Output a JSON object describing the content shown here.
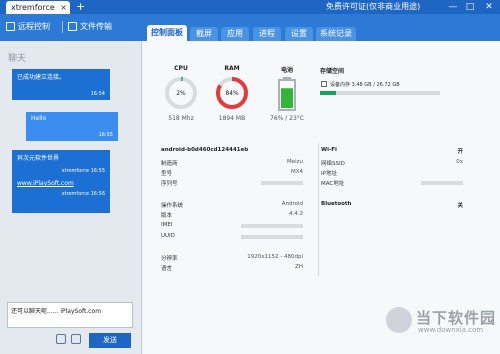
{
  "titlebar": {
    "tab_label": "xtremforce",
    "tab_close": "×",
    "tab_add": "+",
    "license": "免费许可证(仅非商业用途)",
    "min_btn": "—",
    "max_btn": "□",
    "close_btn": "✕"
  },
  "header": {
    "remote_control": "远程控制",
    "file_transfer": "文件传输",
    "tabs": [
      "控制面板",
      "截屏",
      "应用",
      "进程",
      "设置",
      "系统记录"
    ]
  },
  "chat": {
    "title": "聊天",
    "messages": [
      {
        "text": "已成功建立连接。",
        "time": "16:54"
      },
      {
        "text": "Hello",
        "time": "16:55"
      },
      {
        "text": "异次元软件世界",
        "sender": "xtremforce 16:55",
        "link": "www.iPlaySoft.com",
        "sender2": "xtremforce 16:56"
      }
    ],
    "input_value": "还可以聊天呢...... iPlaySoft.com",
    "send_label": "发送"
  },
  "gauges": {
    "cpu": {
      "label": "CPU",
      "value": "2%",
      "percent": 2,
      "sub": "518 Mhz"
    },
    "ram": {
      "label": "RAM",
      "value": "84%",
      "percent": 84,
      "sub": "1894 MB"
    },
    "battery": {
      "label": "电池",
      "percent": 76,
      "sub": "76% / 23°C"
    }
  },
  "storage": {
    "label": "存储空间",
    "text": "设备内存 3.48 GB / 26.72 GB",
    "percent": 13
  },
  "device": {
    "id": "android-b0d460cd124441eb",
    "rows": [
      {
        "k": "制造商",
        "v": "Meizu"
      },
      {
        "k": "型号",
        "v": "MX4"
      },
      {
        "k": "序列号",
        "v": ""
      },
      {
        "k": "操作系统",
        "v": "Android"
      },
      {
        "k": "版本",
        "v": "4.4.2"
      },
      {
        "k": "IMEI",
        "v": ""
      },
      {
        "k": "UUID",
        "v": ""
      },
      {
        "k": "分辨率",
        "v": "1920x1152 - 480dpi"
      },
      {
        "k": "语言",
        "v": "ZH"
      }
    ]
  },
  "network": {
    "wifi_label": "Wi-Fi",
    "wifi_state": "开",
    "ssid_label": "网络SSID",
    "ssid_value": "0x",
    "ip_label": "IP地址",
    "mac_label": "MAC地址",
    "bt_label": "Bluetooth",
    "bt_state": "关"
  },
  "watermark": {
    "text": "当下软件园",
    "url": "www.downxia.com"
  },
  "colors": {
    "brand": "#1f66c2",
    "cpu_ring": "#2bb673",
    "ram_ring": "#e03c3c",
    "battery": "#33b53a",
    "storage_fill": "#18a35a"
  }
}
